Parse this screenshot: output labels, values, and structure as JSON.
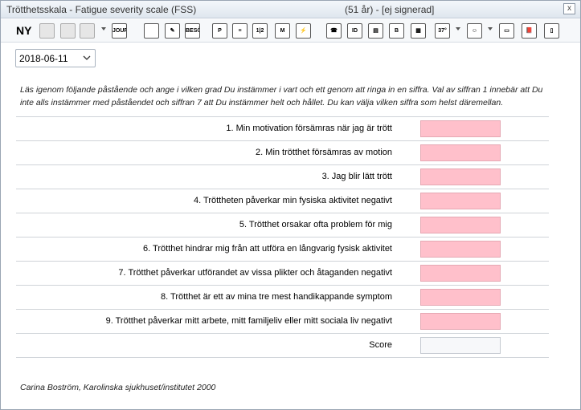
{
  "window": {
    "title": "Trötthetsskala - Fatigue severity scale (FSS)",
    "subtitle": "(51 år) - [ej signerad]",
    "close_label": "x"
  },
  "toolbar": {
    "new_label": "NY",
    "icons": [
      {
        "name": "disabled-icon",
        "text": "",
        "gray": true
      },
      {
        "name": "settings-gray-icon",
        "text": "",
        "gray": true
      },
      {
        "name": "save-icon",
        "text": "",
        "gray": true
      },
      {
        "name": "journal-icon",
        "text": "JOUR"
      },
      {
        "name": "briefcase-icon",
        "text": ""
      },
      {
        "name": "edit-icon",
        "text": "✎"
      },
      {
        "name": "visit-icon",
        "text": "BESÖK"
      },
      {
        "name": "p-icon",
        "text": "P"
      },
      {
        "name": "notes-icon",
        "text": "≡"
      },
      {
        "name": "calendar-icon",
        "text": "1|2"
      },
      {
        "name": "m-icon",
        "text": "M"
      },
      {
        "name": "lightning-icon",
        "text": "⚡"
      },
      {
        "name": "phone-icon",
        "text": "☎"
      },
      {
        "name": "id-icon",
        "text": "ID"
      },
      {
        "name": "card-icon",
        "text": "▤"
      },
      {
        "name": "b-icon",
        "text": "B"
      },
      {
        "name": "map-icon",
        "text": "▦"
      },
      {
        "name": "thermometer-icon",
        "text": "37°"
      },
      {
        "name": "group-icon",
        "text": "☺"
      },
      {
        "name": "scanner-icon",
        "text": "▭"
      },
      {
        "name": "book-icon",
        "text": "📕"
      },
      {
        "name": "device-icon",
        "text": "▯"
      }
    ]
  },
  "date_select": {
    "value": "2018-06-11"
  },
  "instructions": "Läs igenom följande påstående och ange i vilken grad Du instämmer i vart och ett genom att ringa in en siffra. Val av siffran 1 innebär att Du inte alls instämmer med påståendet och siffran 7 att Du instämmer helt och hållet. Du kan välja vilken siffra som helst däremellan.",
  "questions": [
    {
      "label": "1. Min motivation försämras när jag är trött"
    },
    {
      "label": "2. Min trötthet försämras av motion"
    },
    {
      "label": "3. Jag blir lätt trött"
    },
    {
      "label": "4. Tröttheten påverkar min fysiska aktivitet negativt"
    },
    {
      "label": "5. Trötthet orsakar ofta problem för mig"
    },
    {
      "label": "6. Trötthet hindrar mig från att utföra en långvarig fysisk aktivitet"
    },
    {
      "label": "7. Trötthet påverkar utförandet av vissa plikter och åtaganden negativt"
    },
    {
      "label": "8. Trötthet är ett av mina tre mest handikappande symptom"
    },
    {
      "label": "9. Trötthet påverkar mitt arbete, mitt familjeliv eller mitt sociala liv negativt"
    }
  ],
  "score": {
    "label": "Score"
  },
  "footer": "Carina Boström, Karolinska sjukhuset/institutet 2000",
  "colors": {
    "field_required": "#ffc0cb",
    "field_readonly": "#f7f8fa"
  }
}
